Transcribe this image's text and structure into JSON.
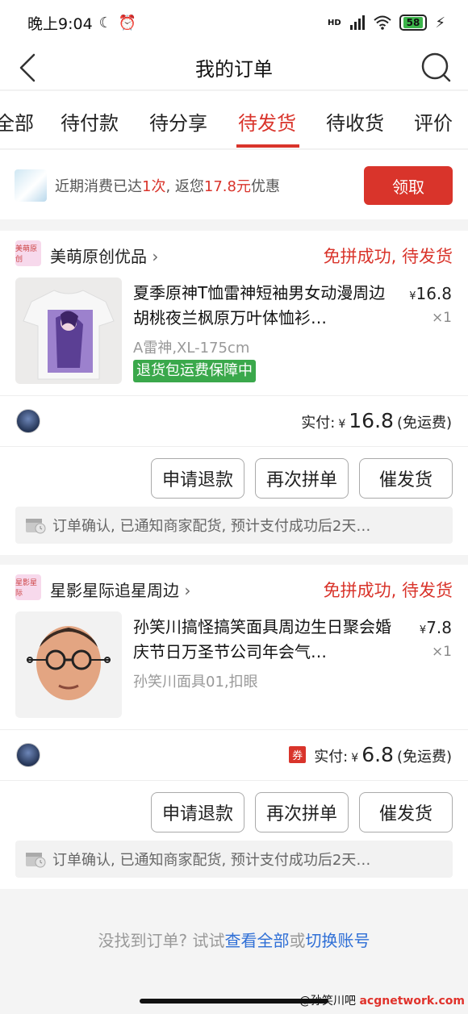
{
  "status_bar": {
    "time": "晚上9:04",
    "signal": "HD",
    "battery": "58"
  },
  "nav": {
    "title": "我的订单"
  },
  "tabs": [
    "全部",
    "待付款",
    "待分享",
    "待发货",
    "待收货",
    "评价"
  ],
  "active_tab": "待发货",
  "promo": {
    "text_before": "近期消费已达",
    "count": "1次",
    "text_mid": ", 返您",
    "amount": "17.8元",
    "text_after": "优惠",
    "button": "领取"
  },
  "orders": [
    {
      "shop_name": "美萌原创优品",
      "shop_logo_text": "美萌原创",
      "status": "免拼成功, 待发货",
      "product_title": "夏季原神T恤雷神短袖男女动漫周边胡桃夜兰枫原万叶体恤衫…",
      "price_symbol": "¥",
      "price": "16.8",
      "quantity": "×1",
      "spec": "A雷神,XL-175cm",
      "badge": "退货包运费保障中",
      "paid_label": "实付:",
      "paid_symbol": "¥",
      "paid_amount": "16.8",
      "shipping_note": "(免运费)",
      "coupon": "",
      "buttons": [
        "申请退款",
        "再次拼单",
        "催发货"
      ],
      "notice": "订单确认, 已通知商家配货, 预计支付成功后2天…"
    },
    {
      "shop_name": "星影星际追星周边",
      "shop_logo_text": "星影星际",
      "status": "免拼成功, 待发货",
      "product_title": "孙笑川搞怪搞笑面具周边生日聚会婚庆节日万圣节公司年会气…",
      "price_symbol": "¥",
      "price": "7.8",
      "quantity": "×1",
      "spec": "孙笑川面具01,扣眼",
      "badge": "",
      "paid_label": "实付:",
      "paid_symbol": "¥",
      "paid_amount": "6.8",
      "shipping_note": "(免运费)",
      "coupon": "券",
      "buttons": [
        "申请退款",
        "再次拼单",
        "催发货"
      ],
      "notice": "订单确认, 已通知商家配货, 预计支付成功后2天…"
    }
  ],
  "footer": {
    "prefix": "没找到订单? 试试",
    "link1": "查看全部",
    "middle": "或",
    "link2": "切换账号"
  },
  "watermark": {
    "handle": "@孙笑川吧",
    "site": "acgnetwork.com"
  },
  "colors": {
    "accent": "#d9342b",
    "badge_green": "#3aa84b",
    "link_blue": "#2f6fd6"
  }
}
